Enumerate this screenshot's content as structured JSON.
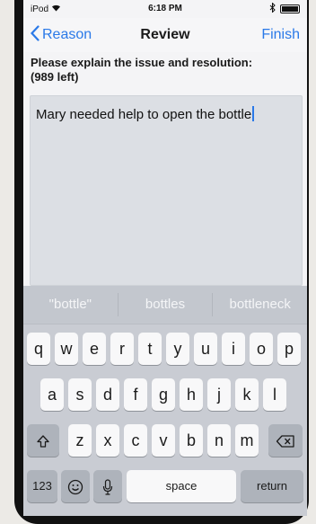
{
  "status_bar": {
    "carrier": "iPod",
    "time": "6:18 PM"
  },
  "nav": {
    "back_label": "Reason",
    "title": "Review",
    "finish_label": "Finish"
  },
  "prompt": {
    "line1": "Please explain the issue and resolution:",
    "line2": "(989 left)"
  },
  "input": {
    "value": "Mary needed help to open the bottle"
  },
  "predictions": [
    "\"bottle\"",
    "bottles",
    "bottleneck"
  ],
  "keyboard": {
    "row1": [
      "q",
      "w",
      "e",
      "r",
      "t",
      "y",
      "u",
      "i",
      "o",
      "p"
    ],
    "row2": [
      "a",
      "s",
      "d",
      "f",
      "g",
      "h",
      "j",
      "k",
      "l"
    ],
    "row3": [
      "z",
      "x",
      "c",
      "v",
      "b",
      "n",
      "m"
    ],
    "numbers_label": "123",
    "space_label": "space",
    "return_label": "return"
  },
  "colors": {
    "accent": "#2a79e8",
    "keyboard_bg": "#c9ccd3"
  },
  "icons": [
    "wifi-icon",
    "bluetooth-icon",
    "battery-icon",
    "chevron-left-icon",
    "shift-icon",
    "backspace-icon",
    "emoji-icon",
    "microphone-icon"
  ]
}
